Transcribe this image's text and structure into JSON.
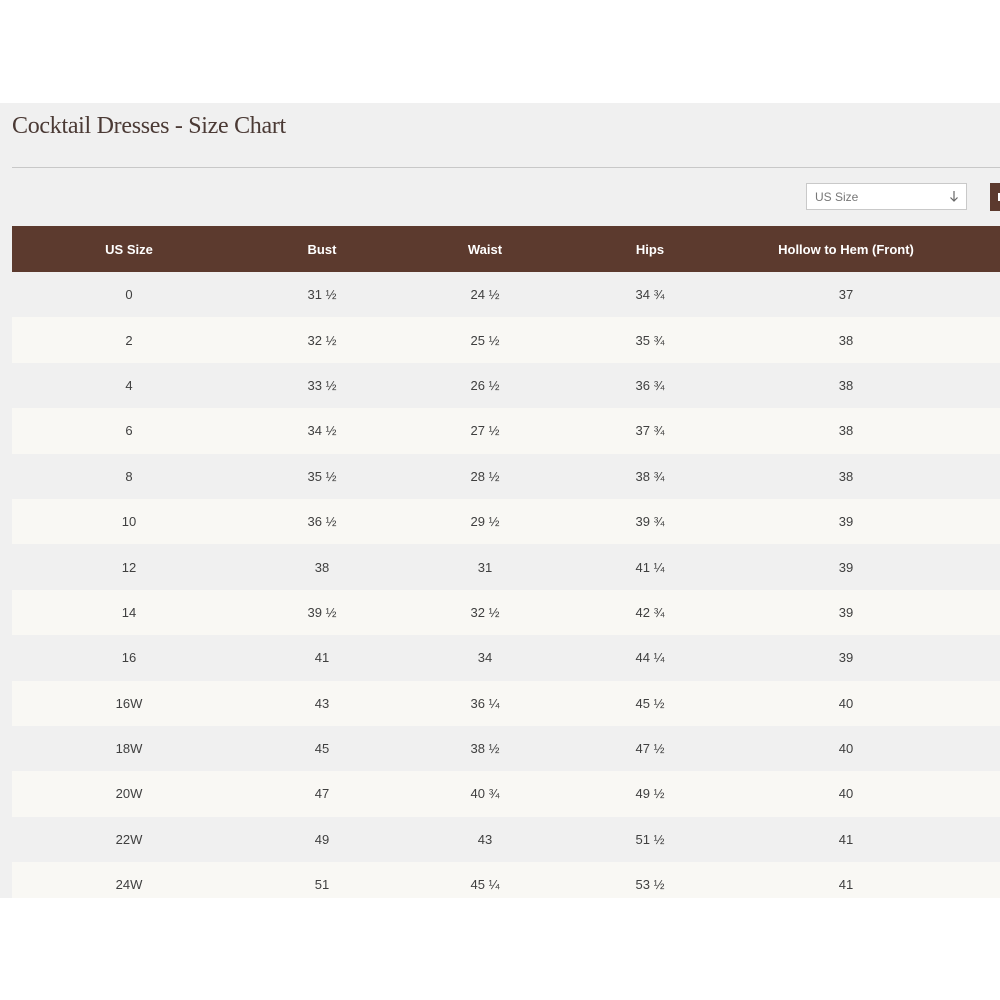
{
  "page": {
    "title": "Cocktail Dresses - Size Chart"
  },
  "controls": {
    "size_select": {
      "value": "US Size",
      "icon": "arrow-down-icon"
    }
  },
  "colors": {
    "header_bg": "#5c3a2e",
    "panel_bg": "#f0f0f0",
    "row_alt_bg": "#f9f8f4",
    "title_color": "#4b3a35"
  },
  "table": {
    "headers": [
      "US Size",
      "Bust",
      "Waist",
      "Hips",
      "Hollow to Hem (Front)"
    ],
    "rows": [
      [
        "0",
        "31 ½",
        "24 ½",
        "34 ¾",
        "37"
      ],
      [
        "2",
        "32 ½",
        "25 ½",
        "35 ¾",
        "38"
      ],
      [
        "4",
        "33 ½",
        "26 ½",
        "36 ¾",
        "38"
      ],
      [
        "6",
        "34 ½",
        "27 ½",
        "37 ¾",
        "38"
      ],
      [
        "8",
        "35 ½",
        "28 ½",
        "38 ¾",
        "38"
      ],
      [
        "10",
        "36 ½",
        "29 ½",
        "39 ¾",
        "39"
      ],
      [
        "12",
        "38",
        "31",
        "41 ¼",
        "39"
      ],
      [
        "14",
        "39 ½",
        "32 ½",
        "42 ¾",
        "39"
      ],
      [
        "16",
        "41",
        "34",
        "44 ¼",
        "39"
      ],
      [
        "16W",
        "43",
        "36 ¼",
        "45 ½",
        "40"
      ],
      [
        "18W",
        "45",
        "38 ½",
        "47 ½",
        "40"
      ],
      [
        "20W",
        "47",
        "40 ¾",
        "49 ½",
        "40"
      ],
      [
        "22W",
        "49",
        "43",
        "51 ½",
        "41"
      ],
      [
        "24W",
        "51",
        "45 ¼",
        "53 ½",
        "41"
      ]
    ]
  }
}
